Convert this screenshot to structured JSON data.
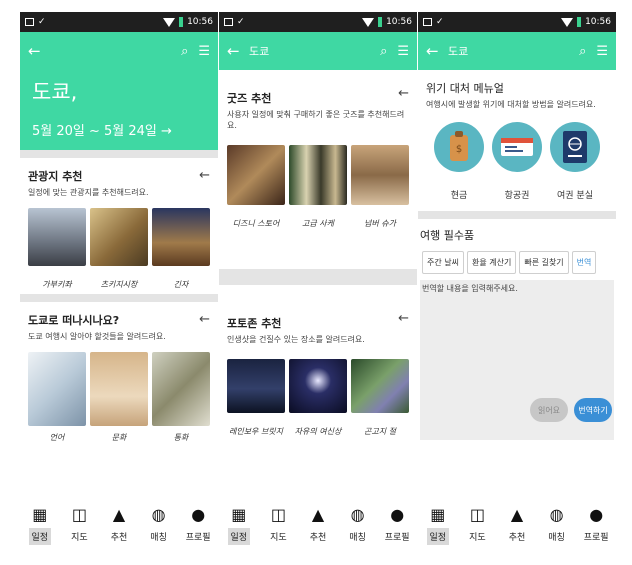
{
  "status": {
    "time": "10:56"
  },
  "screen1": {
    "hero_city": "도쿄,",
    "hero_dates": "5월 20일 ~ 5월 24일  →",
    "section1": {
      "title": "관광지 추천",
      "desc": "일정에 맞는 관광지를 추천해드려요.",
      "items": [
        {
          "caption": "가부키좌"
        },
        {
          "caption": "츠키지시장"
        },
        {
          "caption": "긴자"
        }
      ]
    },
    "section2": {
      "title": "도쿄로 떠나시나요?",
      "desc": "도쿄 여행시 알아야 할것들을 알려드려요.",
      "items": [
        {
          "caption": "언어"
        },
        {
          "caption": "문화"
        },
        {
          "caption": "통화"
        }
      ]
    }
  },
  "screen2": {
    "appbar_title": "도쿄",
    "section1": {
      "title": "굿즈 추천",
      "desc": "사용자 일정에 맞춰 구매하기 좋은 굿즈를 추천해드려요.",
      "items": [
        {
          "caption": "디즈니 스토어"
        },
        {
          "caption": "고급 사케"
        },
        {
          "caption": "넘버 슈가"
        }
      ]
    },
    "section2": {
      "title": "포토존 추천",
      "desc": "인생샷을 건질수 있는 장소를 알려드려요.",
      "items": [
        {
          "caption": "레인보우 브릿지"
        },
        {
          "caption": "자유의 여신상"
        },
        {
          "caption": "곤고지 절"
        }
      ]
    }
  },
  "screen3": {
    "appbar_title": "도쿄",
    "crisis": {
      "title": "위기 대처 메뉴얼",
      "desc": "여행시에 발생할 위기에 대처할 방법을 알려드려요.",
      "items": [
        {
          "caption": "현금"
        },
        {
          "caption": "항공권"
        },
        {
          "caption": "여권 분실"
        }
      ]
    },
    "essentials": {
      "title": "여행 필수품",
      "buttons": [
        "주간 날씨",
        "환율 계산기",
        "빠른 길찾기",
        "번역"
      ]
    },
    "translate": {
      "placeholder": "번역할 내용을 입력해주세요.",
      "listen_label": "읽어요",
      "translate_label": "번역하기"
    }
  },
  "nav": [
    "일정",
    "지도",
    "추천",
    "매칭",
    "프로필"
  ],
  "colors": {
    "accent": "#3fd8a3",
    "blue": "#3a8fd6",
    "circle": "#5ab6c2"
  }
}
